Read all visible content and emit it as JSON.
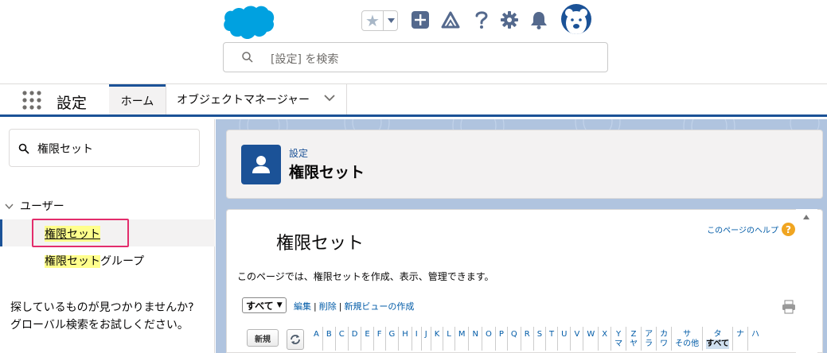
{
  "header": {
    "search_placeholder": "[設定] を検索",
    "icons": [
      "favorites-star-icon",
      "add-icon",
      "trailhead-icon",
      "help-icon",
      "settings-icon",
      "notifications-icon",
      "avatar"
    ]
  },
  "appnav": {
    "app_name": "設定",
    "tabs": [
      {
        "label": "ホーム",
        "active": true
      },
      {
        "label": "オブジェクトマネージャー",
        "active": false
      }
    ]
  },
  "sidebar": {
    "quickfind_value": "権限セット",
    "section": "ユーザー",
    "items": [
      {
        "label": "権限セット",
        "selected": true
      },
      {
        "label_hl": "権限セット",
        "label_rest": "グループ",
        "selected": false
      }
    ],
    "notfound_line1": "探しているものが見つかりませんか?",
    "notfound_line2": "グローバル検索をお試しください。"
  },
  "pageheader": {
    "breadcrumb": "設定",
    "title": "権限セット"
  },
  "content": {
    "title": "権限セット",
    "help_link": "このページのヘルプ",
    "description": "このページでは、権限セットを作成、表示、管理できます。",
    "view_select": "すべて",
    "links": [
      "編集",
      "削除",
      "新規ビューの作成"
    ],
    "new_button": "新規",
    "alphabet": [
      [
        "A",
        ""
      ],
      [
        "B",
        ""
      ],
      [
        "C",
        ""
      ],
      [
        "D",
        ""
      ],
      [
        "E",
        ""
      ],
      [
        "F",
        ""
      ],
      [
        "G",
        ""
      ],
      [
        "H",
        ""
      ],
      [
        "I",
        ""
      ],
      [
        "J",
        ""
      ],
      [
        "K",
        ""
      ],
      [
        "L",
        ""
      ],
      [
        "M",
        ""
      ],
      [
        "N",
        ""
      ],
      [
        "O",
        ""
      ],
      [
        "P",
        ""
      ],
      [
        "Q",
        ""
      ],
      [
        "R",
        ""
      ],
      [
        "S",
        ""
      ],
      [
        "T",
        ""
      ],
      [
        "U",
        ""
      ],
      [
        "V",
        ""
      ],
      [
        "W",
        ""
      ],
      [
        "X",
        ""
      ],
      [
        "Y",
        "マ"
      ],
      [
        "Z",
        "ヤ"
      ],
      [
        "ア",
        "ラ"
      ],
      [
        "カ",
        "ワ"
      ],
      [
        "サ",
        "その他"
      ],
      [
        "タ",
        "すべて"
      ],
      [
        "ナ",
        ""
      ],
      [
        "ハ",
        ""
      ]
    ],
    "alphabet_selected": "タ"
  },
  "colors": {
    "brand": "#1b5297",
    "highlight": "#ffff8c",
    "callout": "#e32d6c",
    "link": "#015ba7"
  }
}
